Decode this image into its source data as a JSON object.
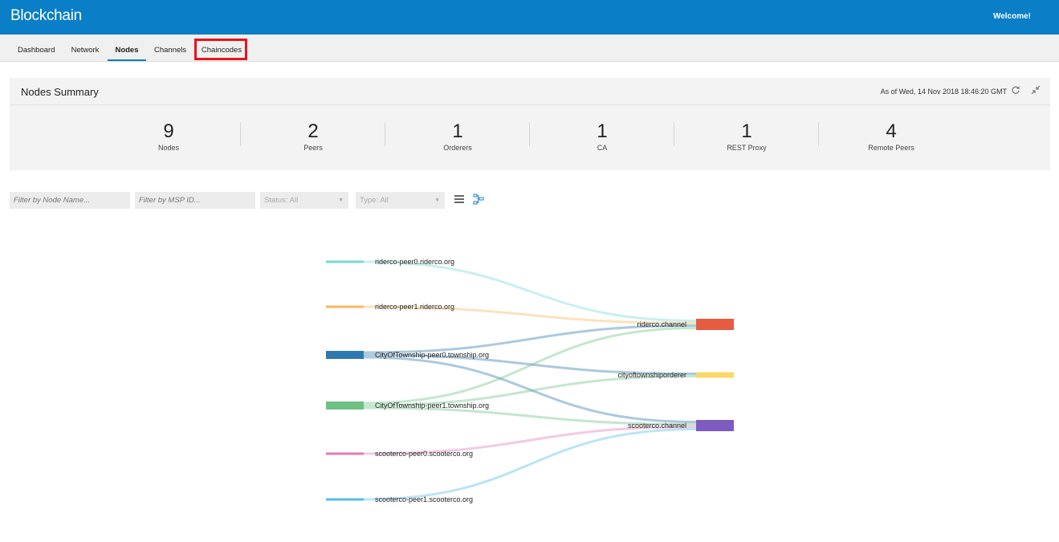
{
  "app": {
    "title": "Blockchain",
    "welcome": "Welcome!"
  },
  "tabs": [
    {
      "label": "Dashboard"
    },
    {
      "label": "Network"
    },
    {
      "label": "Nodes",
      "active": true
    },
    {
      "label": "Channels"
    },
    {
      "label": "Chaincodes"
    }
  ],
  "summary": {
    "title": "Nodes Summary",
    "timestamp": "As of Wed, 14 Nov 2018 18:46:20 GMT",
    "stats": [
      {
        "value": "9",
        "label": "Nodes"
      },
      {
        "value": "2",
        "label": "Peers"
      },
      {
        "value": "1",
        "label": "Orderers"
      },
      {
        "value": "1",
        "label": "CA"
      },
      {
        "value": "1",
        "label": "REST Proxy"
      },
      {
        "value": "4",
        "label": "Remote Peers"
      }
    ]
  },
  "filters": {
    "node_name_placeholder": "Filter by Node Name...",
    "msp_id_placeholder": "Filter by MSP ID...",
    "status": "Status: All",
    "type": "Type: All"
  },
  "graph": {
    "nodes": [
      {
        "id": "n0",
        "label": "riderco-peer0.riderco.org",
        "color": "#76dad6"
      },
      {
        "id": "n1",
        "label": "riderco-peer1.riderco.org",
        "color": "#f8b660"
      },
      {
        "id": "n2",
        "label": "CityOfTownship-peer0.township.org",
        "color": "#2f79b0"
      },
      {
        "id": "n3",
        "label": "CityOfTownship-peer1.township.org",
        "color": "#6fc084"
      },
      {
        "id": "n4",
        "label": "scooterco-peer0.scooterco.org",
        "color": "#e07bb6"
      },
      {
        "id": "n5",
        "label": "scooterco-peer1.scooterco.org",
        "color": "#55bce8"
      }
    ],
    "channels": [
      {
        "id": "c0",
        "label": "riderco.channel",
        "color": "#e55c43"
      },
      {
        "id": "c1",
        "label": "cityoftownshiporderer",
        "color": "#f8d86a"
      },
      {
        "id": "c2",
        "label": "scooterco.channel",
        "color": "#7e5bc0"
      }
    ],
    "links": [
      {
        "source": "n0",
        "target": "c0"
      },
      {
        "source": "n1",
        "target": "c0"
      },
      {
        "source": "n2",
        "target": "c0"
      },
      {
        "source": "n2",
        "target": "c1"
      },
      {
        "source": "n2",
        "target": "c2"
      },
      {
        "source": "n3",
        "target": "c0"
      },
      {
        "source": "n3",
        "target": "c1"
      },
      {
        "source": "n3",
        "target": "c2"
      },
      {
        "source": "n4",
        "target": "c2"
      },
      {
        "source": "n5",
        "target": "c2"
      }
    ]
  }
}
